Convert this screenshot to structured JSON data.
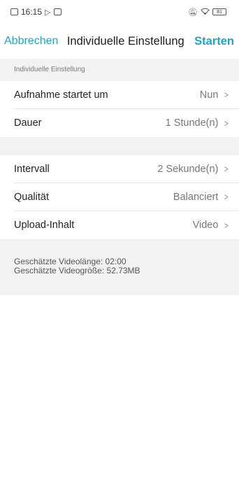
{
  "status_bar": {
    "time": "16:15",
    "battery": "81"
  },
  "nav": {
    "cancel_label": "Abbrechen",
    "title": "Individuelle Einstellung",
    "start_label": "Starten"
  },
  "section_header": "Individuelle Einstellung",
  "group1": [
    {
      "label": "Aufnahme startet um",
      "value": "Nun"
    },
    {
      "label": "Dauer",
      "value": "1 Stunde(n)"
    }
  ],
  "group2": [
    {
      "label": "Intervall",
      "value": "2 Sekunde(n)"
    },
    {
      "label": "Qualität",
      "value": "Balanciert"
    },
    {
      "label": "Upload-Inhalt",
      "value": "Video"
    }
  ],
  "estimate": {
    "length": "Geschätzte Videolänge: 02:00",
    "size": "Geschätzte Videogröße: 52.73MB"
  },
  "colors": {
    "accent": "#1aa6c8",
    "background": "#f2f2f4"
  }
}
